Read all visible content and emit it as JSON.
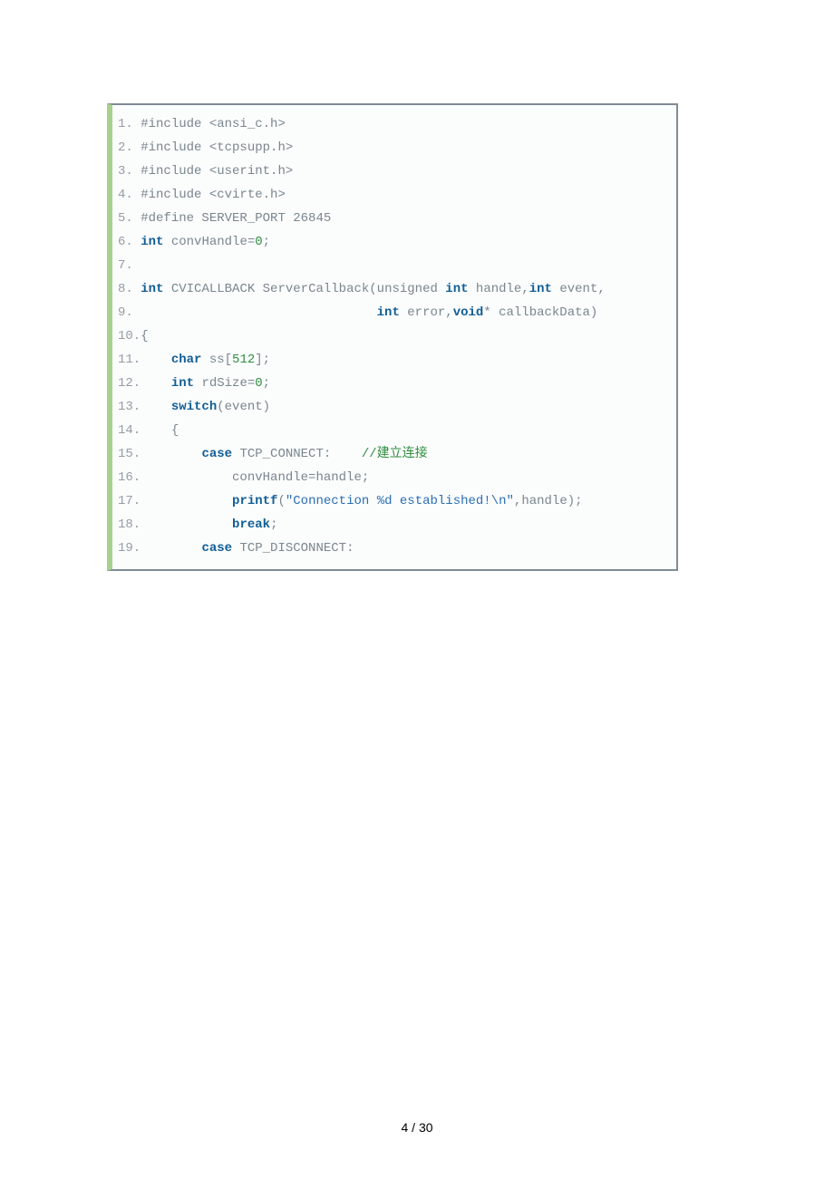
{
  "code": {
    "lines": [
      {
        "n": "1.",
        "segs": [
          {
            "t": " ",
            "c": ""
          },
          {
            "t": "#include <ansi_c.h>",
            "c": "pp"
          }
        ]
      },
      {
        "n": "2.",
        "segs": [
          {
            "t": " ",
            "c": ""
          },
          {
            "t": "#include <tcpsupp.h>",
            "c": "pp"
          }
        ]
      },
      {
        "n": "3.",
        "segs": [
          {
            "t": " ",
            "c": ""
          },
          {
            "t": "#include <userint.h>",
            "c": "pp"
          }
        ]
      },
      {
        "n": "4.",
        "segs": [
          {
            "t": " ",
            "c": ""
          },
          {
            "t": "#include <cvirte.h>",
            "c": "pp"
          }
        ]
      },
      {
        "n": "5.",
        "segs": [
          {
            "t": " ",
            "c": ""
          },
          {
            "t": "#define SERVER_PORT 26845",
            "c": "pp"
          }
        ]
      },
      {
        "n": "6.",
        "segs": [
          {
            "t": " ",
            "c": ""
          },
          {
            "t": "int",
            "c": "kw"
          },
          {
            "t": " convHandle=",
            "c": "ident"
          },
          {
            "t": "0",
            "c": "grn"
          },
          {
            "t": ";",
            "c": "ident"
          }
        ]
      },
      {
        "n": "7.",
        "segs": []
      },
      {
        "n": "8.",
        "segs": [
          {
            "t": " ",
            "c": ""
          },
          {
            "t": "int",
            "c": "kw"
          },
          {
            "t": " CVICALLBACK ServerCallback(unsigned ",
            "c": "ident"
          },
          {
            "t": "int",
            "c": "kw"
          },
          {
            "t": " handle,",
            "c": "ident"
          },
          {
            "t": "int",
            "c": "kw"
          },
          {
            "t": " event,",
            "c": "ident"
          }
        ]
      },
      {
        "n": "9.",
        "segs": [
          {
            "t": "                                ",
            "c": ""
          },
          {
            "t": "int",
            "c": "kw"
          },
          {
            "t": " error,",
            "c": "ident"
          },
          {
            "t": "void",
            "c": "kw"
          },
          {
            "t": "* callbackData)",
            "c": "ident"
          }
        ]
      },
      {
        "n": "10.",
        "segs": [
          {
            "t": "{",
            "c": "ident"
          }
        ]
      },
      {
        "n": "11.",
        "segs": [
          {
            "t": "    ",
            "c": ""
          },
          {
            "t": "char",
            "c": "kw"
          },
          {
            "t": " ss[",
            "c": "ident"
          },
          {
            "t": "512",
            "c": "grn"
          },
          {
            "t": "];",
            "c": "ident"
          }
        ]
      },
      {
        "n": "12.",
        "segs": [
          {
            "t": "    ",
            "c": ""
          },
          {
            "t": "int",
            "c": "kw"
          },
          {
            "t": " rdSize=",
            "c": "ident"
          },
          {
            "t": "0",
            "c": "grn"
          },
          {
            "t": ";",
            "c": "ident"
          }
        ]
      },
      {
        "n": "13.",
        "segs": [
          {
            "t": "    ",
            "c": ""
          },
          {
            "t": "switch",
            "c": "kw"
          },
          {
            "t": "(event)",
            "c": "ident"
          }
        ]
      },
      {
        "n": "14.",
        "segs": [
          {
            "t": "    {",
            "c": "ident"
          }
        ]
      },
      {
        "n": "15.",
        "segs": [
          {
            "t": "        ",
            "c": ""
          },
          {
            "t": "case",
            "c": "kw"
          },
          {
            "t": " TCP_CONNECT:    ",
            "c": "ident"
          },
          {
            "t": "//建立连接",
            "c": "cmt"
          }
        ]
      },
      {
        "n": "16.",
        "segs": [
          {
            "t": "            convHandle=handle;",
            "c": "ident"
          }
        ]
      },
      {
        "n": "17.",
        "segs": [
          {
            "t": "            ",
            "c": ""
          },
          {
            "t": "printf",
            "c": "kw"
          },
          {
            "t": "(",
            "c": "ident"
          },
          {
            "t": "\"Connection %d established!\\n\"",
            "c": "str"
          },
          {
            "t": ",handle);",
            "c": "ident"
          }
        ]
      },
      {
        "n": "18.",
        "segs": [
          {
            "t": "            ",
            "c": ""
          },
          {
            "t": "break",
            "c": "kw"
          },
          {
            "t": ";",
            "c": "ident"
          }
        ]
      },
      {
        "n": "19.",
        "segs": [
          {
            "t": "        ",
            "c": ""
          },
          {
            "t": "case",
            "c": "kw"
          },
          {
            "t": " TCP_DISCONNECT:",
            "c": "ident"
          }
        ]
      }
    ]
  },
  "footer": {
    "page_label": "4 / 30"
  }
}
